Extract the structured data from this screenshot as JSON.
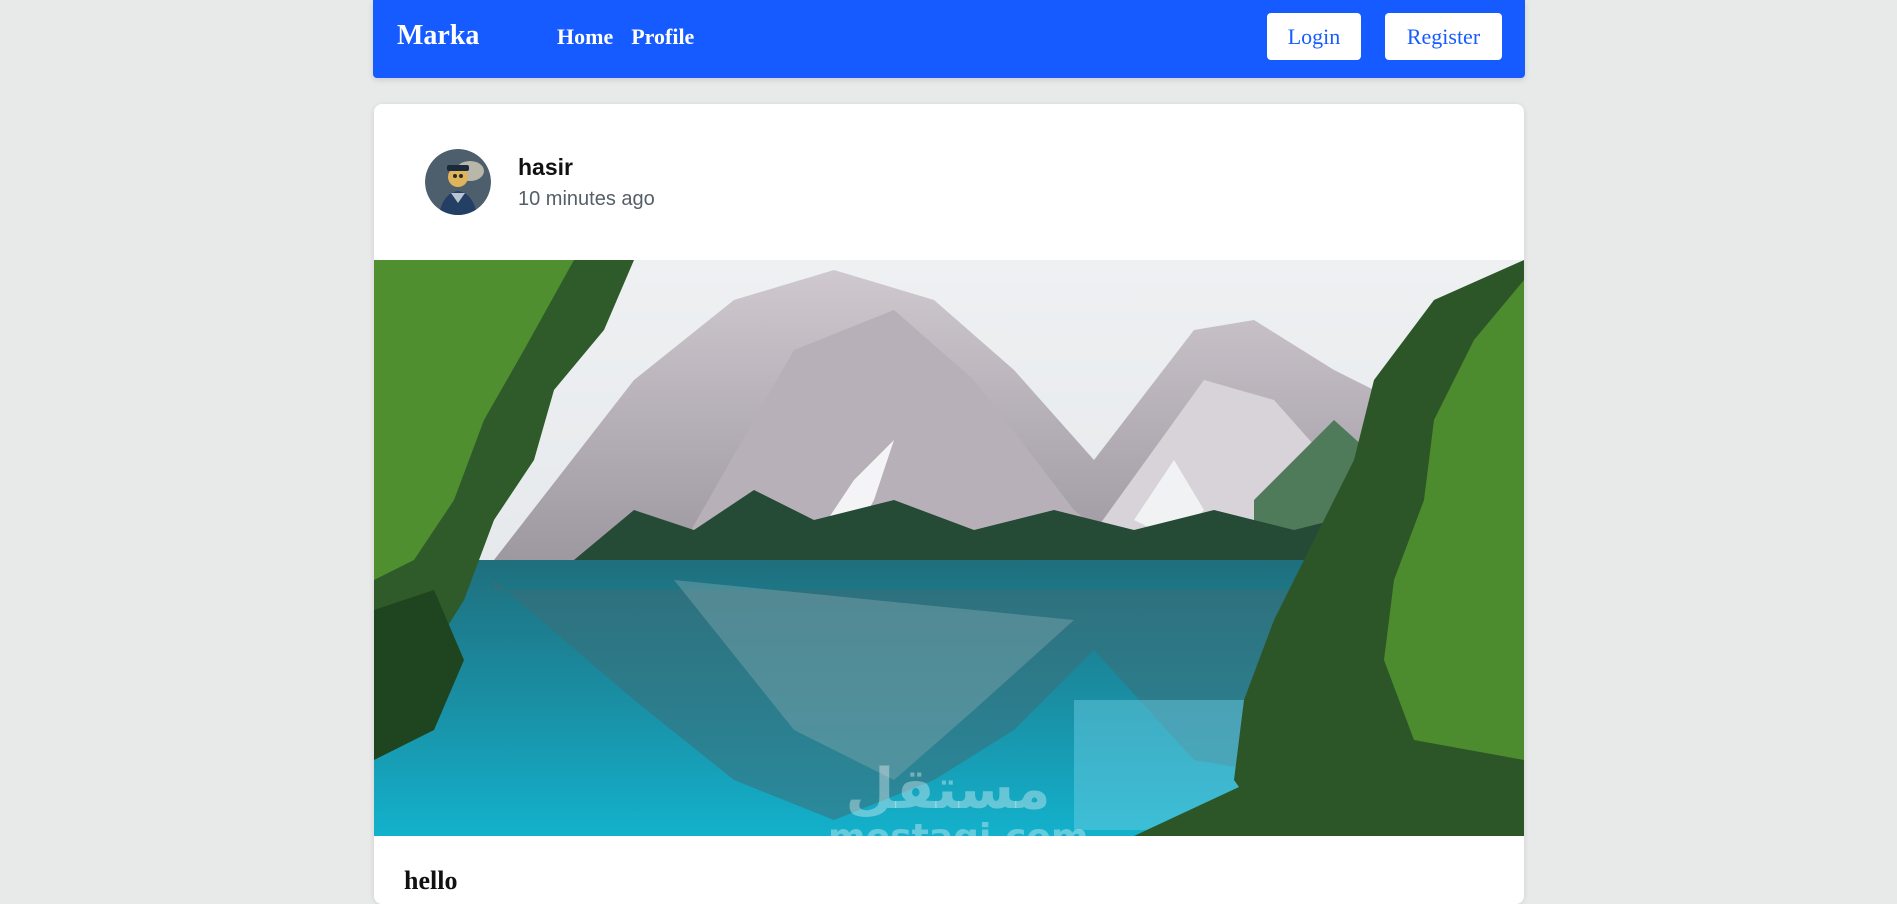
{
  "navbar": {
    "brand": "Marka",
    "links": [
      "Home",
      "Profile"
    ],
    "login_label": "Login",
    "register_label": "Register",
    "background_color": "#155bff"
  },
  "post": {
    "author": "hasir",
    "timestamp": "10 minutes ago",
    "avatar_icon": "user-avatar",
    "image_description_icon": "landscape-image",
    "body": "hello"
  },
  "watermark": {
    "arabic": "مستقل",
    "latin": "mostaqi.com"
  }
}
